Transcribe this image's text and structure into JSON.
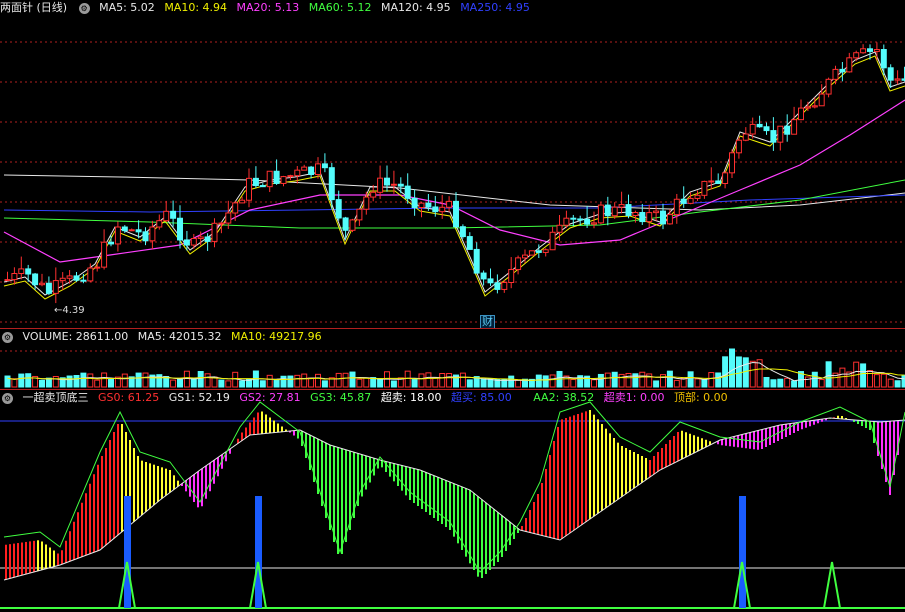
{
  "price_panel": {
    "title": "两面针 (日线)",
    "indicators": [
      {
        "label": "MA5: 5.02",
        "color": "#e8e8e8"
      },
      {
        "label": "MA10: 4.94",
        "color": "#f0f000"
      },
      {
        "label": "MA20: 5.13",
        "color": "#ff40ff"
      },
      {
        "label": "MA60: 5.12",
        "color": "#40ff40"
      },
      {
        "label": "MA120: 4.95",
        "color": "#e8e8e8"
      },
      {
        "label": "MA250: 4.95",
        "color": "#3040ff"
      }
    ],
    "low_marker": "←4.39",
    "event_badge": "财"
  },
  "volume_panel": {
    "indicators": [
      {
        "label": "VOLUME: 28611.00",
        "color": "#e8e8e8"
      },
      {
        "label": "MA5: 42015.32",
        "color": "#e8e8e8"
      },
      {
        "label": "MA10: 49217.96",
        "color": "#f0f000"
      }
    ]
  },
  "indicator_panel": {
    "title": "一超卖顶底三",
    "indicators": [
      {
        "label": "GS0: 61.25",
        "color": "#ff3030"
      },
      {
        "label": "GS1: 52.19",
        "color": "#e8e8e8"
      },
      {
        "label": "GS2: 27.81",
        "color": "#ff40ff"
      },
      {
        "label": "GS3: 45.87",
        "color": "#40ff40"
      },
      {
        "label": "超卖: 18.00",
        "color": "#ffffff"
      },
      {
        "label": "超买: 85.00",
        "color": "#3040ff"
      },
      {
        "label": "AA2: 38.52",
        "color": "#40ff40"
      },
      {
        "label": "超卖1: 0.00",
        "color": "#ff40ff"
      },
      {
        "label": "顶部: 0.00",
        "color": "#f0c000"
      }
    ]
  },
  "colors": {
    "up": "#ff3030",
    "down": "#54fcfc",
    "grid": "#b02020",
    "signal": "#1a5cff"
  }
}
